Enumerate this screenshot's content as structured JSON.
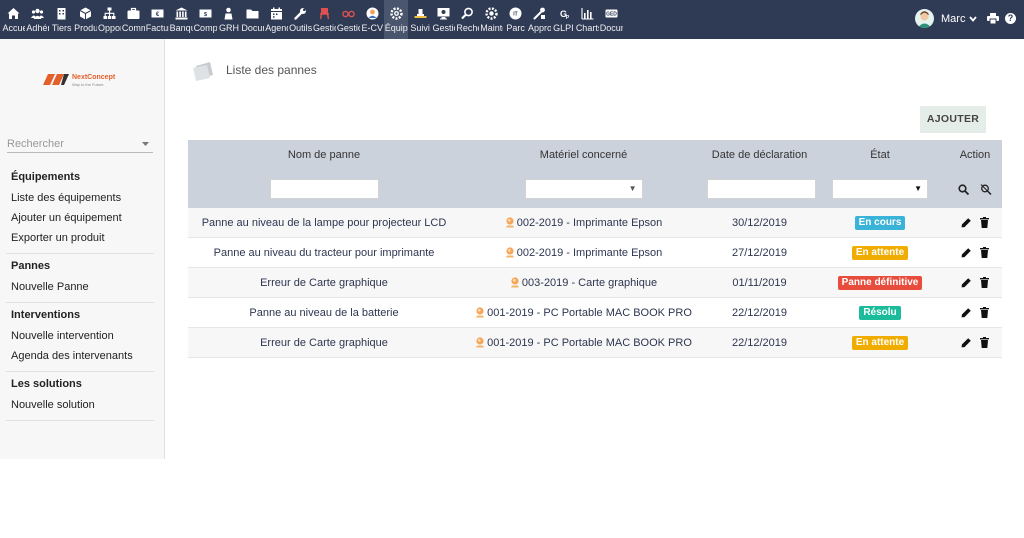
{
  "topbar": {
    "items": [
      {
        "label": "Accueil",
        "icon": "home-icon"
      },
      {
        "label": "Adhérents",
        "icon": "users-icon"
      },
      {
        "label": "Tiers",
        "icon": "building-icon"
      },
      {
        "label": "Produits",
        "icon": "cube-icon"
      },
      {
        "label": "Opportunités",
        "icon": "sitemap-icon"
      },
      {
        "label": "Commercial",
        "icon": "briefcase-icon"
      },
      {
        "label": "Facturation",
        "icon": "invoice-icon"
      },
      {
        "label": "Banque",
        "icon": "bank-icon"
      },
      {
        "label": "Compta",
        "icon": "money-icon"
      },
      {
        "label": "GRH",
        "icon": "person-icon"
      },
      {
        "label": "Documents",
        "icon": "folder-icon"
      },
      {
        "label": "Agenda",
        "icon": "calendar-icon"
      },
      {
        "label": "Outils",
        "icon": "wrench-icon"
      },
      {
        "label": "Gestion",
        "icon": "chair-icon"
      },
      {
        "label": "Gestion",
        "icon": "glasses-icon"
      },
      {
        "label": "E-CV",
        "icon": "face-icon"
      },
      {
        "label": "Équipements",
        "icon": "gear-icon"
      },
      {
        "label": "Suivi",
        "icon": "desk-icon"
      },
      {
        "label": "Gestion",
        "icon": "monitor-icon"
      },
      {
        "label": "Recherche",
        "icon": "magnifier-icon"
      },
      {
        "label": "Maintenance",
        "icon": "cog-icon"
      },
      {
        "label": "Parc",
        "icon": "parc-icon"
      },
      {
        "label": "Approvisionnement",
        "icon": "tools-icon"
      },
      {
        "label": "GLPI",
        "icon": "glpi-icon"
      },
      {
        "label": "Charts",
        "icon": "chart-icon"
      },
      {
        "label": "Documents",
        "icon": "ged-icon"
      }
    ],
    "active_index": 16,
    "user_name": "Marc",
    "nav_color": "#2f3a55"
  },
  "sidebar": {
    "logo_name": "NextConcept",
    "logo_tagline": "Way to the Future",
    "search_placeholder": "Rechercher",
    "groups": [
      {
        "title": "Équipements",
        "links": [
          "Liste des équipements",
          "Ajouter un équipement",
          "Exporter un produit"
        ]
      },
      {
        "title": "Pannes",
        "links": [
          "Nouvelle Panne"
        ]
      },
      {
        "title": "Interventions",
        "links": [
          "Nouvelle intervention",
          "Agenda des intervenants"
        ]
      },
      {
        "title": "Les solutions",
        "links": [
          "Nouvelle solution"
        ]
      }
    ]
  },
  "main": {
    "title": "Liste des pannes",
    "add_label": "AJOUTER",
    "columns": [
      "Nom de panne",
      "Matériel concerné",
      "Date de déclaration",
      "État",
      "Action"
    ],
    "rows": [
      {
        "name": "Panne au niveau de la lampe pour projecteur LCD",
        "material": "002-2019 - Imprimante Epson",
        "date": "30/12/2019",
        "status": "En cours",
        "status_color": "#39b3d7"
      },
      {
        "name": "Panne au niveau du tracteur pour imprimante",
        "material": "002-2019 - Imprimante Epson",
        "date": "27/12/2019",
        "status": "En attente",
        "status_color": "#f0ad00"
      },
      {
        "name": "Erreur de Carte graphique",
        "material": "003-2019 - Carte graphique",
        "date": "01/11/2019",
        "status": "Panne définitive",
        "status_color": "#e74c3c"
      },
      {
        "name": "Panne au niveau de la batterie",
        "material": "001-2019 - PC Portable MAC BOOK PRO",
        "date": "22/12/2019",
        "status": "Résolu",
        "status_color": "#1abc9c"
      },
      {
        "name": "Erreur de Carte graphique",
        "material": "001-2019 - PC Portable MAC BOOK PRO",
        "date": "22/12/2019",
        "status": "En attente",
        "status_color": "#f0ad00"
      }
    ]
  }
}
